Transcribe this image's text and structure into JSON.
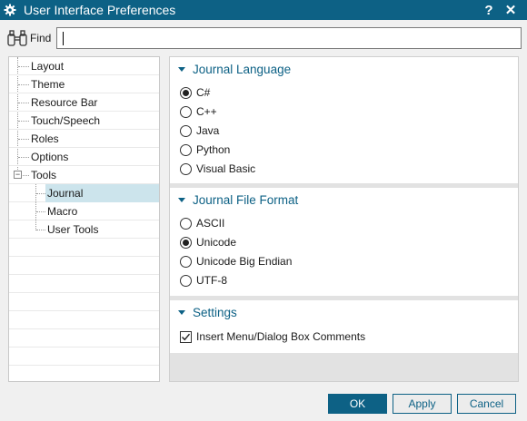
{
  "window": {
    "title": "User Interface Preferences",
    "help_label": "?",
    "close_label": "✕"
  },
  "find": {
    "label": "Find",
    "value": ""
  },
  "tree": {
    "items": [
      {
        "label": "Layout"
      },
      {
        "label": "Theme"
      },
      {
        "label": "Resource Bar"
      },
      {
        "label": "Touch/Speech"
      },
      {
        "label": "Roles"
      },
      {
        "label": "Options"
      },
      {
        "label": "Tools",
        "expander": "−"
      },
      {
        "label": "Journal"
      },
      {
        "label": "Macro"
      },
      {
        "label": "User Tools"
      }
    ]
  },
  "sections": {
    "journal_language": {
      "title": "Journal Language",
      "options": [
        "C#",
        "C++",
        "Java",
        "Python",
        "Visual Basic"
      ],
      "selected": "C#"
    },
    "journal_file_format": {
      "title": "Journal File Format",
      "options": [
        "ASCII",
        "Unicode",
        "Unicode Big Endian",
        "UTF-8"
      ],
      "selected": "Unicode"
    },
    "settings": {
      "title": "Settings",
      "checkbox_label": "Insert Menu/Dialog Box Comments",
      "checked": true
    }
  },
  "buttons": {
    "ok": "OK",
    "apply": "Apply",
    "cancel": "Cancel"
  },
  "colors": {
    "accent": "#0d6185",
    "selection": "#cce4ec"
  }
}
